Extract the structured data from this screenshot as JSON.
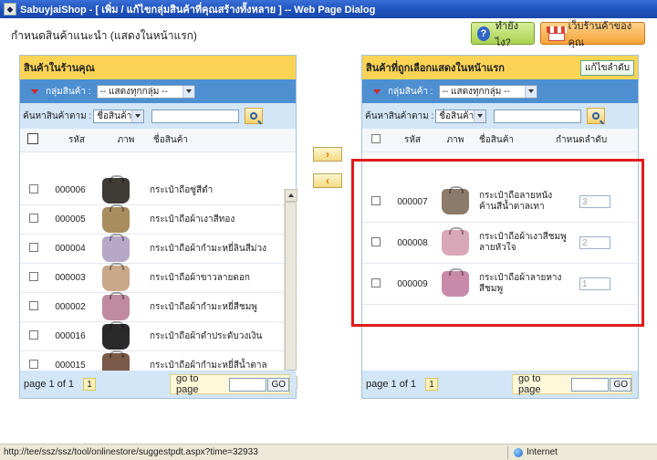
{
  "window": {
    "title": "SabuyjaiShop - [ เพิ่ม / แก้ไขกลุ่มสินค้าที่คุณสร้างทั้งหลาย ] -- Web Page Dialog"
  },
  "page": {
    "heading": "กำหนดสินค้าแนะนำ (แสดงในหน้าแรก)",
    "help_label": "ทำยังไง?",
    "shop_label": "เว็บร้านค้าของคุณ"
  },
  "left_panel": {
    "title": "สินค้าในร้านคุณ",
    "group_label": "กลุ่มสินค้า :",
    "group_value": "-- แสดงทุกกลุ่ม --",
    "search_label": "ค้นหาสินค้าตาม :",
    "search_field": "ชื่อสินค้า",
    "col_code": "รหัส",
    "col_image": "ภาพ",
    "col_name": "ชื่อสินค้า",
    "rows": [
      {
        "code": "000006",
        "name": "กระเป๋าถือซู่สีดำ"
      },
      {
        "code": "000005",
        "name": "กระเป๋าถือผ้าเงาสีทอง"
      },
      {
        "code": "000004",
        "name": "กระเป๋าถือผ้ากำมะหยี่ลินสีม่วง"
      },
      {
        "code": "000003",
        "name": "กระเป๋าถือผ้าขาวลายดอก"
      },
      {
        "code": "000002",
        "name": "กระเป๋าถือผ้ากำมะหยี่สีชมพู"
      },
      {
        "code": "000016",
        "name": "กระเป๋าถือผ้าดำประดับวงเงิน"
      },
      {
        "code": "000015",
        "name": "กระเป๋าถือผ้ากำมะหยี่สีน้ำตาล"
      }
    ],
    "page_text": "page 1 of 1",
    "page_num": "1",
    "goto_label": "go to page",
    "go_label": "GO"
  },
  "middle": {
    "add": "›",
    "remove": "‹"
  },
  "right_panel": {
    "title": "สินค้าที่ถูกเลือกแสดงในหน้าแรก",
    "fix_button": "แก้ไขลำดับ",
    "group_label": "กลุ่มสินค้า :",
    "group_value": "-- แสดงทุกกลุ่ม --",
    "search_label": "ค้นหาสินค้าตาม :",
    "search_field": "ชื่อสินค้า",
    "col_code": "รหัส",
    "col_image": "ภาพ",
    "col_name": "ชื่อสินค้า",
    "col_rank": "กำหนดลำดับ",
    "rows": [
      {
        "code": "000007",
        "name": "กระเป๋าถือลายหนังค้านสีน้ำตาลเทา",
        "rank": "3"
      },
      {
        "code": "000008",
        "name": "กระเป๋าถือผ้าเงาสีชมพูลายหัวใจ",
        "rank": "2"
      },
      {
        "code": "000009",
        "name": "กระเป๋าถือผ้าลายหางสีชมพู",
        "rank": "1"
      }
    ],
    "page_text": "page 1 of 1",
    "page_num": "1",
    "goto_label": "go to page",
    "go_label": "GO"
  },
  "statusbar": {
    "url": "http://tee/ssz/ssz/tool/onlinestore/suggestpdt.aspx?time=32933",
    "zone": "Internet"
  },
  "colors": {
    "header_yellow": "#fbd456",
    "group_blue": "#4d8fd0",
    "search_blue": "#d2e6f7",
    "highlight_red": "#e01b1b"
  },
  "product_colors": {
    "left": [
      "#3e3a36",
      "#a88d5e",
      "#b8a8c8",
      "#c9a88a",
      "#c08aa0",
      "#2a2a2a",
      "#7a5a48"
    ],
    "right": [
      "#8c7a6a",
      "#d8a8b8",
      "#c88aa8"
    ]
  }
}
